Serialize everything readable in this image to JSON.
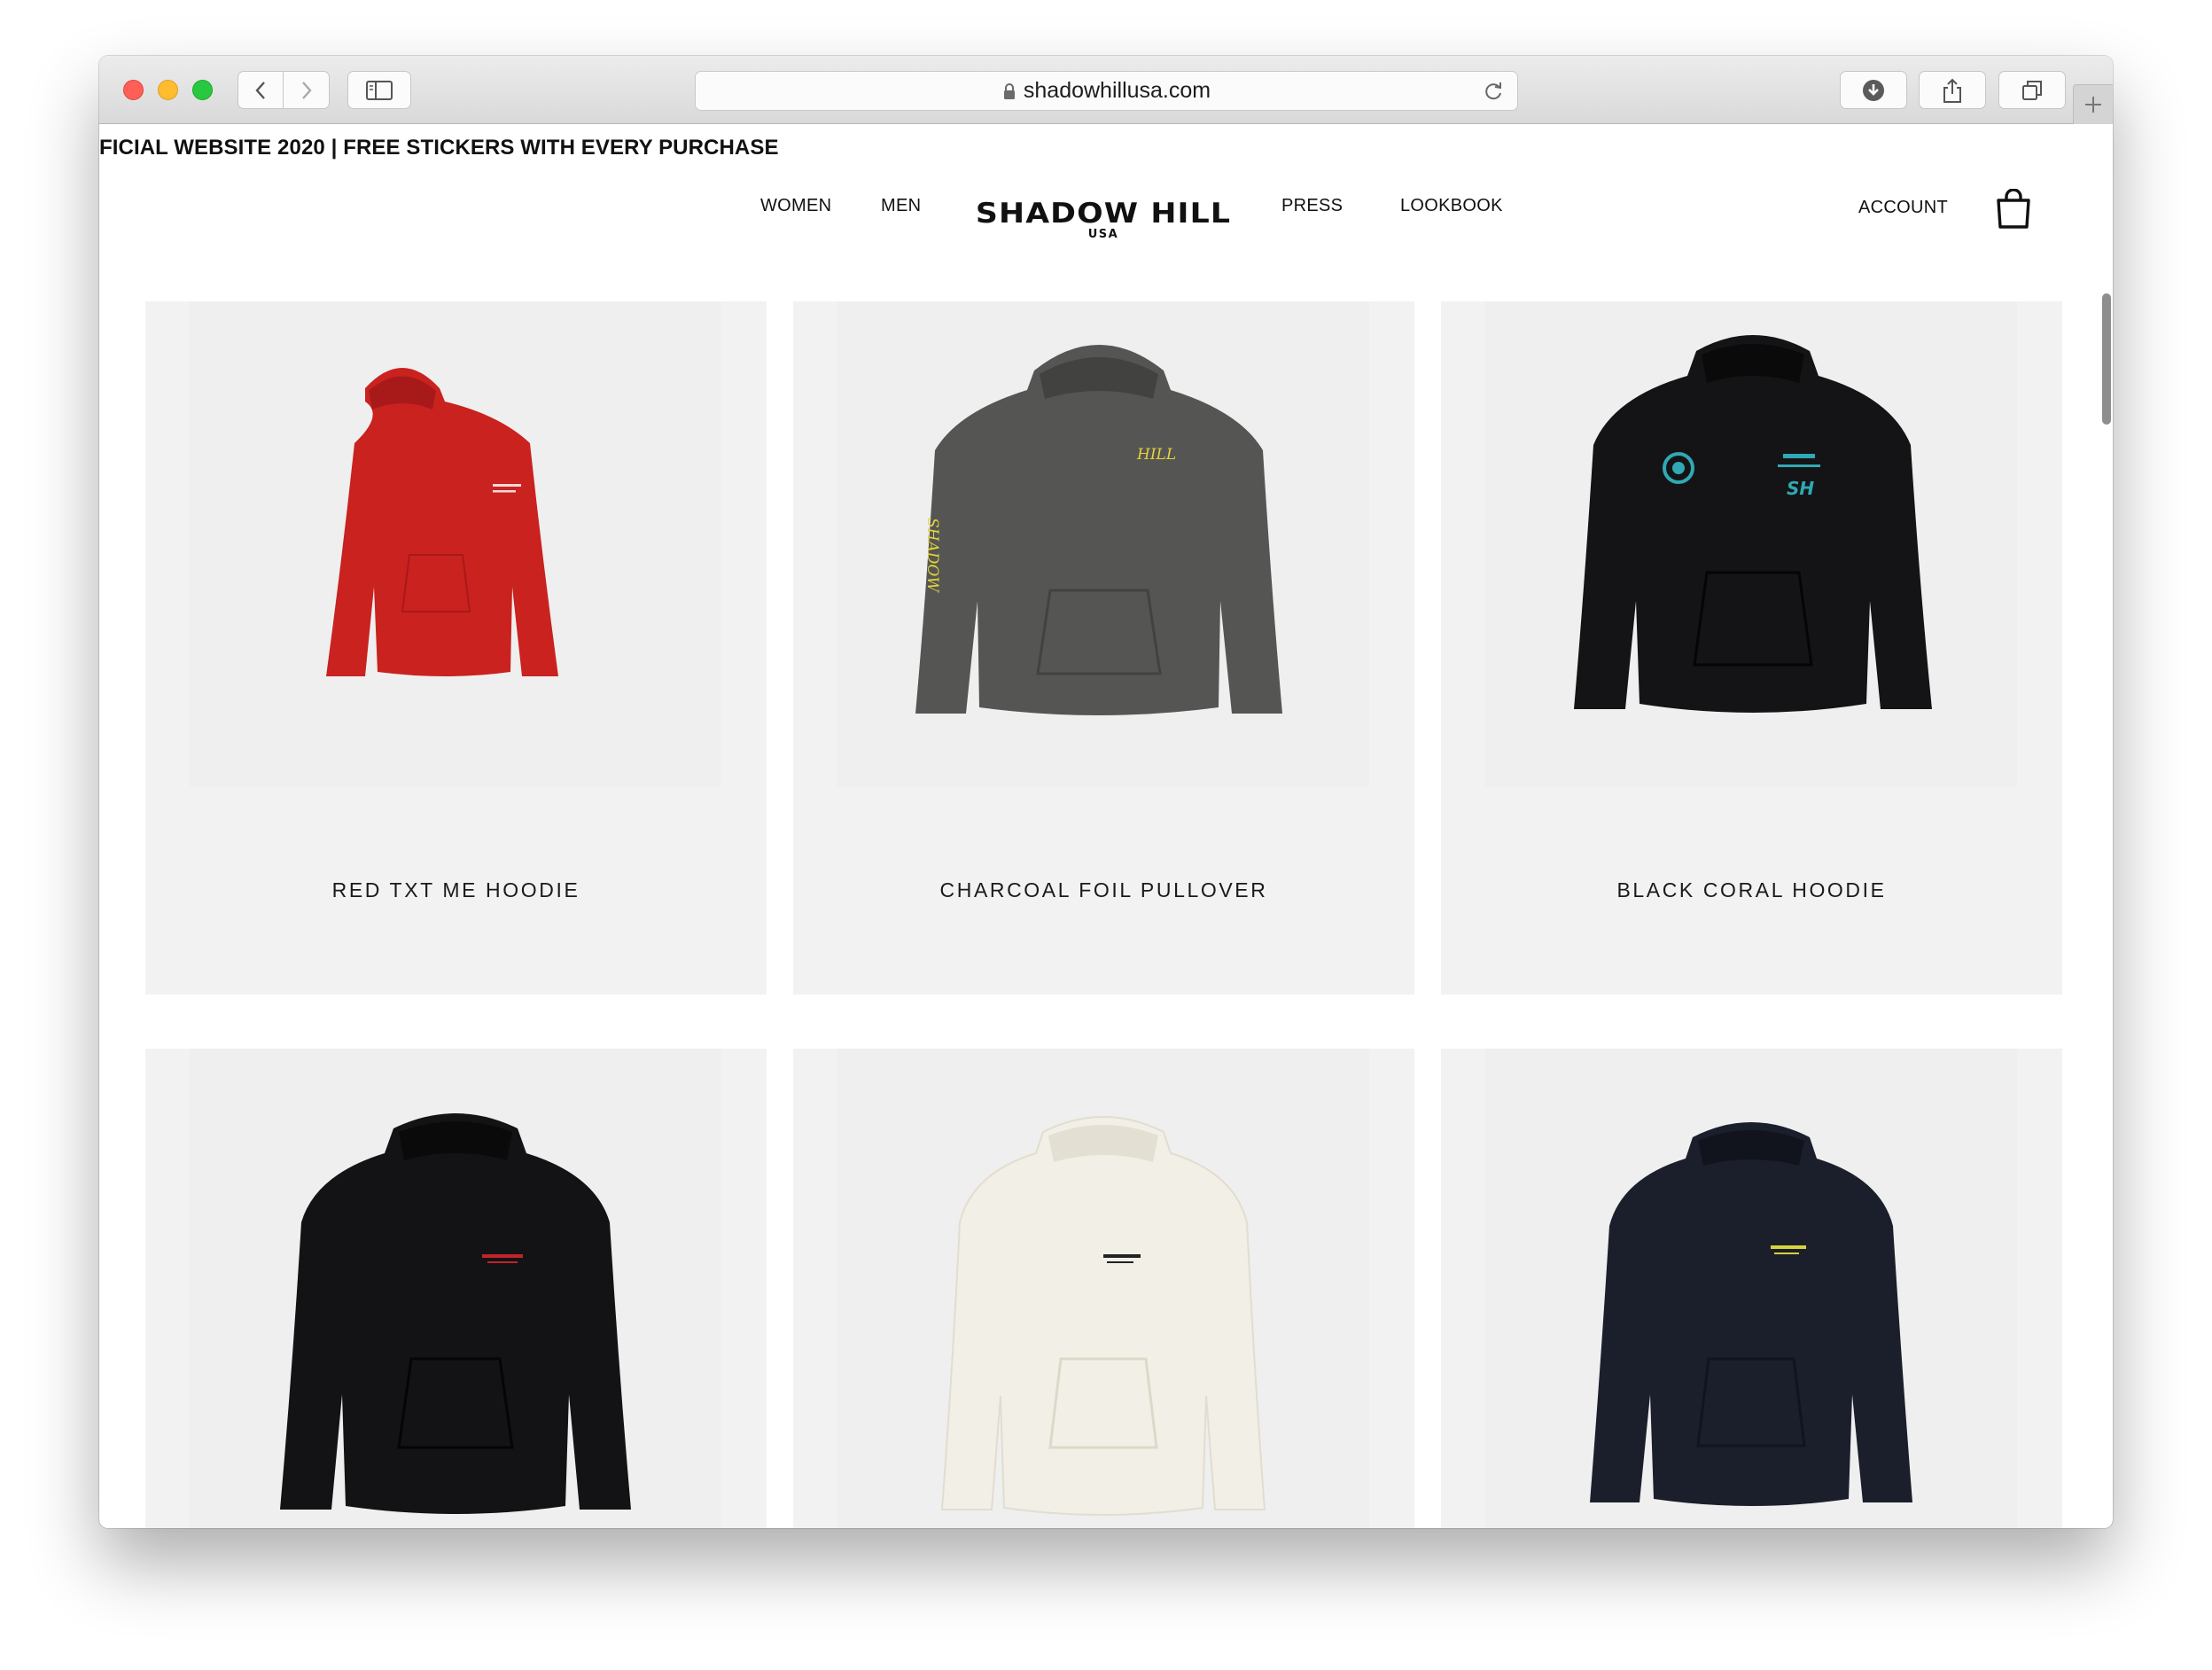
{
  "browser": {
    "url": "shadowhillusa.com",
    "buttons": {
      "back": "back",
      "forward": "forward",
      "sidebar": "sidebar",
      "download": "download",
      "share": "share",
      "tabs": "tabs",
      "new_tab": "new tab"
    }
  },
  "promo": {
    "text": "FICIAL WEBSITE 2020 | FREE STICKERS WITH EVERY PURCHASE"
  },
  "nav": {
    "women": "WOMEN",
    "men": "MEN",
    "press": "PRESS",
    "lookbook": "LOOKBOOK",
    "account": "ACCOUNT"
  },
  "logo": {
    "main": "SHADOW HILL",
    "sub": "USA"
  },
  "products": [
    {
      "name": "RED TXT ME HOODIE",
      "color": "#c9221f",
      "icon": "hoodie-icon"
    },
    {
      "name": "CHARCOAL FOIL PULLOVER",
      "color": "#555553",
      "icon": "hoodie-icon",
      "print": "HILL",
      "print_color": "#e4d43c"
    },
    {
      "name": "BLACK CORAL HOODIE",
      "color": "#141416",
      "icon": "hoodie-icon",
      "print_color": "#2fa9b5"
    },
    {
      "name": "",
      "color": "#131315",
      "icon": "hoodie-icon",
      "print_color": "#c3232a"
    },
    {
      "name": "",
      "color": "#f2efe6",
      "icon": "hoodie-icon",
      "print_color": "#222222"
    },
    {
      "name": "",
      "color": "#1b1e2b",
      "icon": "hoodie-icon",
      "print_color": "#d7d23a"
    }
  ]
}
